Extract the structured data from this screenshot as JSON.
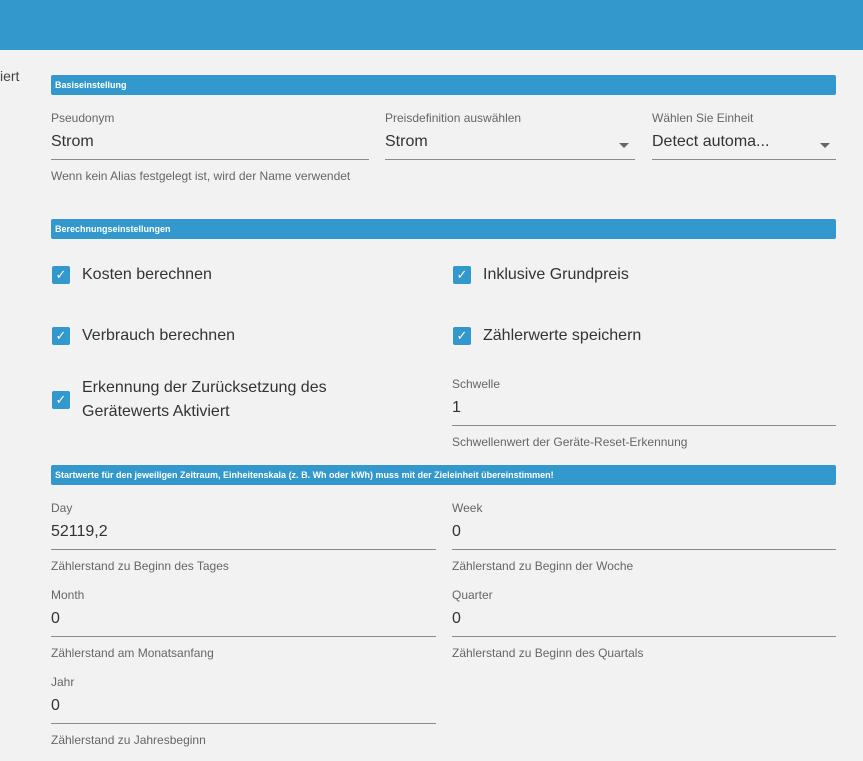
{
  "header": {
    "cut_text": "iert"
  },
  "sections": {
    "basic": "Basiseinstellung",
    "calc": "Berechnungseinstellungen",
    "start": "Startwerte für den jeweiligen Zeitraum, Einheitenskala (z. B. Wh oder kWh) muss mit der Zieleinheit übereinstimmen!"
  },
  "basic": {
    "alias": {
      "label": "Pseudonym",
      "value": "Strom",
      "help": "Wenn kein Alias festgelegt ist, wird der Name verwendet"
    },
    "price": {
      "label": "Preisdefinition auswählen",
      "value": "Strom"
    },
    "unit": {
      "label": "Wählen Sie Einheit",
      "value": "Detect automa..."
    }
  },
  "calc": {
    "costs": {
      "label": "Kosten berechnen",
      "checked": true
    },
    "base_price": {
      "label": "Inklusive Grundpreis",
      "checked": true
    },
    "consumption": {
      "label": "Verbrauch berechnen",
      "checked": true
    },
    "meter_values": {
      "label": "Zählerwerte speichern",
      "checked": true
    },
    "reset_detection": {
      "label": "Erkennung der Zurücksetzung des Gerätewerts Aktiviert",
      "checked": true
    },
    "threshold": {
      "label": "Schwelle",
      "value": "1",
      "help": "Schwellenwert der Geräte-Reset-Erkennung"
    }
  },
  "start": {
    "day": {
      "label": "Day",
      "value": "52119,2",
      "help": "Zählerstand zu Beginn des Tages"
    },
    "week": {
      "label": "Week",
      "value": "0",
      "help": "Zählerstand zu Beginn der Woche"
    },
    "month": {
      "label": "Month",
      "value": "0",
      "help": "Zählerstand am Monatsanfang"
    },
    "quarter": {
      "label": "Quarter",
      "value": "0",
      "help": "Zählerstand zu Beginn des Quartals"
    },
    "year": {
      "label": "Jahr",
      "value": "0",
      "help": "Zählerstand zu Jahresbeginn"
    }
  },
  "icons": {
    "checkbox": "check-icon",
    "dropdown": "dropdown-arrow-icon"
  },
  "colors": {
    "accent": "#3399cc",
    "background": "#f2f2f2"
  }
}
